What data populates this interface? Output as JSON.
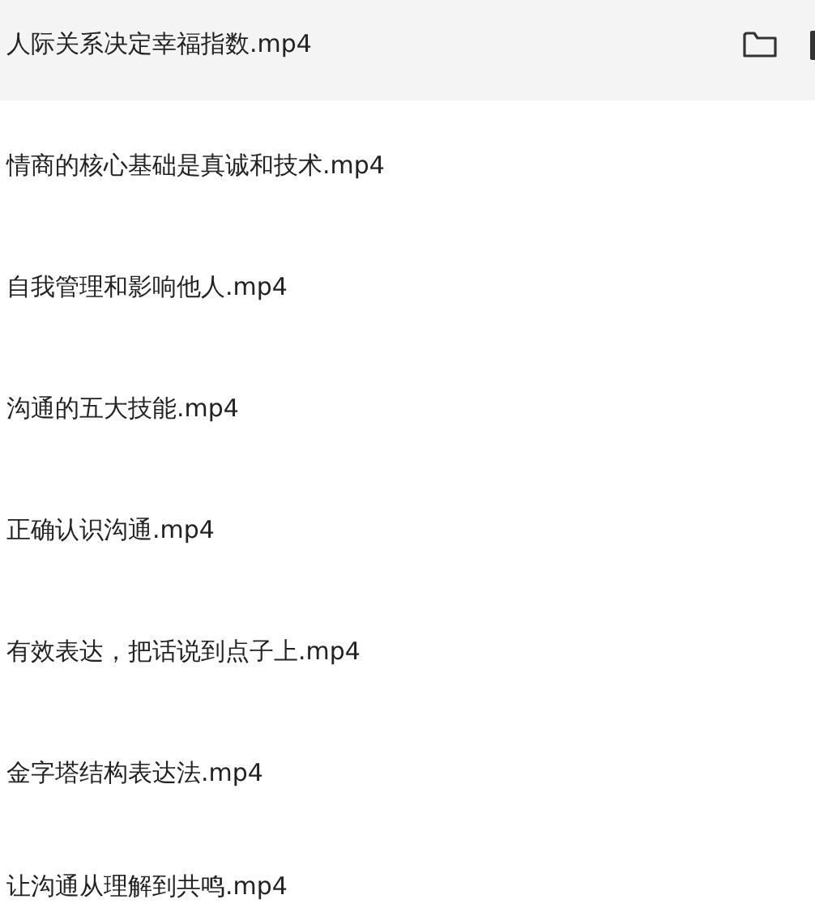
{
  "files": [
    {
      "name": "人际关系决定幸福指数.mp4",
      "selected": true
    },
    {
      "name": "情商的核心基础是真诚和技术.mp4",
      "selected": false
    },
    {
      "name": "自我管理和影响他人.mp4",
      "selected": false
    },
    {
      "name": "沟通的五大技能.mp4",
      "selected": false
    },
    {
      "name": "正确认识沟通.mp4",
      "selected": false
    },
    {
      "name": "有效表达，把话说到点子上.mp4",
      "selected": false
    },
    {
      "name": "金字塔结构表达法.mp4",
      "selected": false
    },
    {
      "name": "让沟通从理解到共鸣.mp4",
      "selected": false
    }
  ]
}
